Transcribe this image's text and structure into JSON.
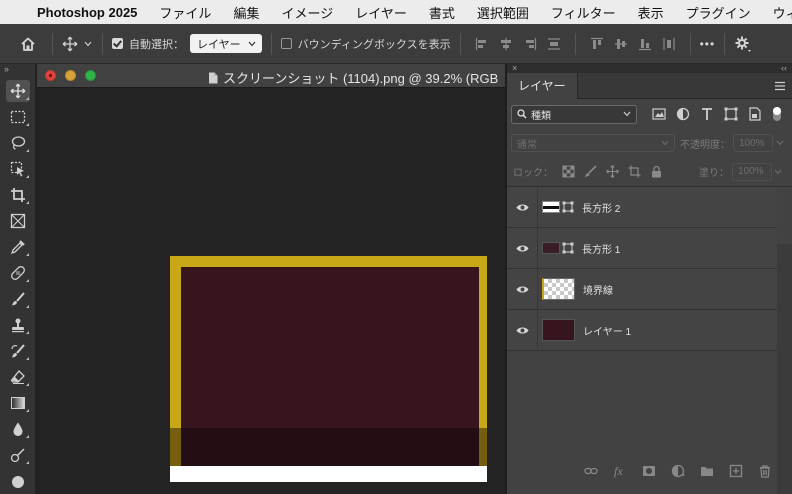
{
  "menubar": {
    "app_name": "Photoshop 2025",
    "items": [
      "ファイル",
      "編集",
      "イメージ",
      "レイヤー",
      "書式",
      "選択範囲",
      "フィルター",
      "表示",
      "プラグイン",
      "ウィンドウ"
    ]
  },
  "options_bar": {
    "auto_select_label": "自動選択：",
    "auto_select_checked": true,
    "auto_select_target": "レイヤー",
    "bounding_box_label": "バウンディングボックスを表示",
    "bounding_box_checked": false,
    "more_label": "•••"
  },
  "document": {
    "title": "スクリーンショット (1104).png @ 39.2% (RGB",
    "canvas_colors": {
      "frame": "#c8a817",
      "fill": "#36151f",
      "shadow": "#250d14",
      "bottom": "#ffffff"
    }
  },
  "layers_panel": {
    "tab_label": "レイヤー",
    "kind_filter": "種類",
    "blend_mode": "通常",
    "opacity_label": "不透明度：",
    "opacity_value": "100%",
    "lock_label": "ロック：",
    "fill_label": "塗り：",
    "fill_value": "100%",
    "layers": [
      {
        "name": "長方形 2",
        "thumb": "rect2",
        "visible": true
      },
      {
        "name": "長方形 1",
        "thumb": "rect1",
        "visible": true
      },
      {
        "name": "境界線",
        "thumb": "border",
        "visible": true
      },
      {
        "name": "レイヤー 1",
        "thumb": "fill",
        "visible": true
      }
    ]
  },
  "colors": {
    "menubar_bg": "#ececec",
    "panel_bg": "#424242",
    "accent_yellow": "#c8a817",
    "accent_maroon": "#36151f"
  }
}
